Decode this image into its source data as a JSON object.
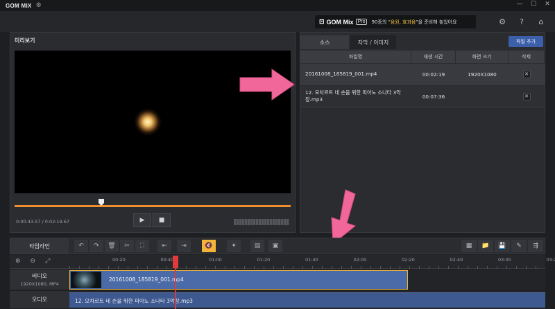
{
  "app": {
    "title": "GOM MIX"
  },
  "promo": {
    "logo": "GOM Mix",
    "badge": "Pro",
    "text_prefix": "90종의 \"",
    "text_highlight": "음원, 효과음",
    "text_suffix": "\"을 준비해 놓았어요"
  },
  "preview": {
    "title": "미리보기",
    "time_current": "0:00:43.57",
    "time_total": "0:02:19.67",
    "progress": 0.31
  },
  "source": {
    "tabs": [
      "소스",
      "자막 / 이미지"
    ],
    "add_file_label": "파일 추가",
    "columns": [
      "파일명",
      "재생 시간",
      "화면 크기",
      "삭제"
    ],
    "rows": [
      {
        "name": "20161008_185819_001.mp4",
        "duration": "00:02:19",
        "size": "1920X1080"
      },
      {
        "name": "12. 모차르트 네 손을 위한 피아노 소나타 3악장.mp3",
        "duration": "00:07:36",
        "size": ""
      }
    ],
    "delete_glyph": "✕"
  },
  "timeline": {
    "label": "타임라인",
    "ruler_ticks": [
      "00:20",
      "00:40",
      "01:00",
      "01:20",
      "01:40",
      "02:00",
      "02:20",
      "02:40",
      "03:00",
      "03:20"
    ],
    "video_track": {
      "name": "비디오",
      "sub": "1920X1080, MP4",
      "clip": "20161008_185819_001.mp4"
    },
    "audio_track": {
      "name": "오디오",
      "clip": "12. 모차르트 네 손을 위한 피아노 소나타 3악장.mp3"
    }
  },
  "colors": {
    "accent": "#f08d2c",
    "clip_blue": "#4a6aa8",
    "arrow_pink": "#f2679a",
    "mute_yellow": "#f1b53a"
  }
}
